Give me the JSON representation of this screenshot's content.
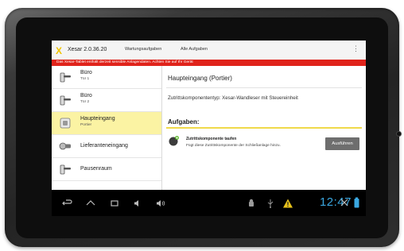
{
  "app": {
    "logo": "X",
    "title": "Xesar 2.0.36.20",
    "tabs": [
      "Wartungsaufgaben",
      "Alle Aufgaben"
    ],
    "menu_icon": "overflow-menu-icon"
  },
  "warning_text": "Das Xesar-Tablet enthält derzeit sensible Anlagendaten. Achten Sie auf Ihr Gerät",
  "list": {
    "items": [
      {
        "name": "Büro",
        "sub": "Tür 1",
        "icon": "door-handle-icon"
      },
      {
        "name": "Büro",
        "sub": "Tür 2",
        "icon": "door-handle-icon"
      },
      {
        "name": "Haupteingang",
        "sub": "Portier",
        "icon": "wall-reader-icon",
        "selected": true
      },
      {
        "name": "Lieferanteneingang",
        "sub": "",
        "icon": "cylinder-icon"
      },
      {
        "name": "Pausenraum",
        "sub": "",
        "icon": "door-handle-icon"
      }
    ]
  },
  "detail": {
    "title": "Haupteingang (Portier)",
    "type_line": "Zutrittskomponententyp: Xesar-Wandleser mit Steuereinheit",
    "tasks_heading": "Aufgaben:",
    "task": {
      "title": "Zutrittskomponente taufen",
      "description": "Fügt diese Zutrittskomponente der Schließanlage hinzu.",
      "button": "Ausführen"
    }
  },
  "status_bar": {
    "time": "12:47",
    "accent_color": "#3aa7e0"
  },
  "colors": {
    "warning": "#e0231b",
    "selected": "#fbf3a3",
    "accent_yellow": "#f0d94a"
  }
}
